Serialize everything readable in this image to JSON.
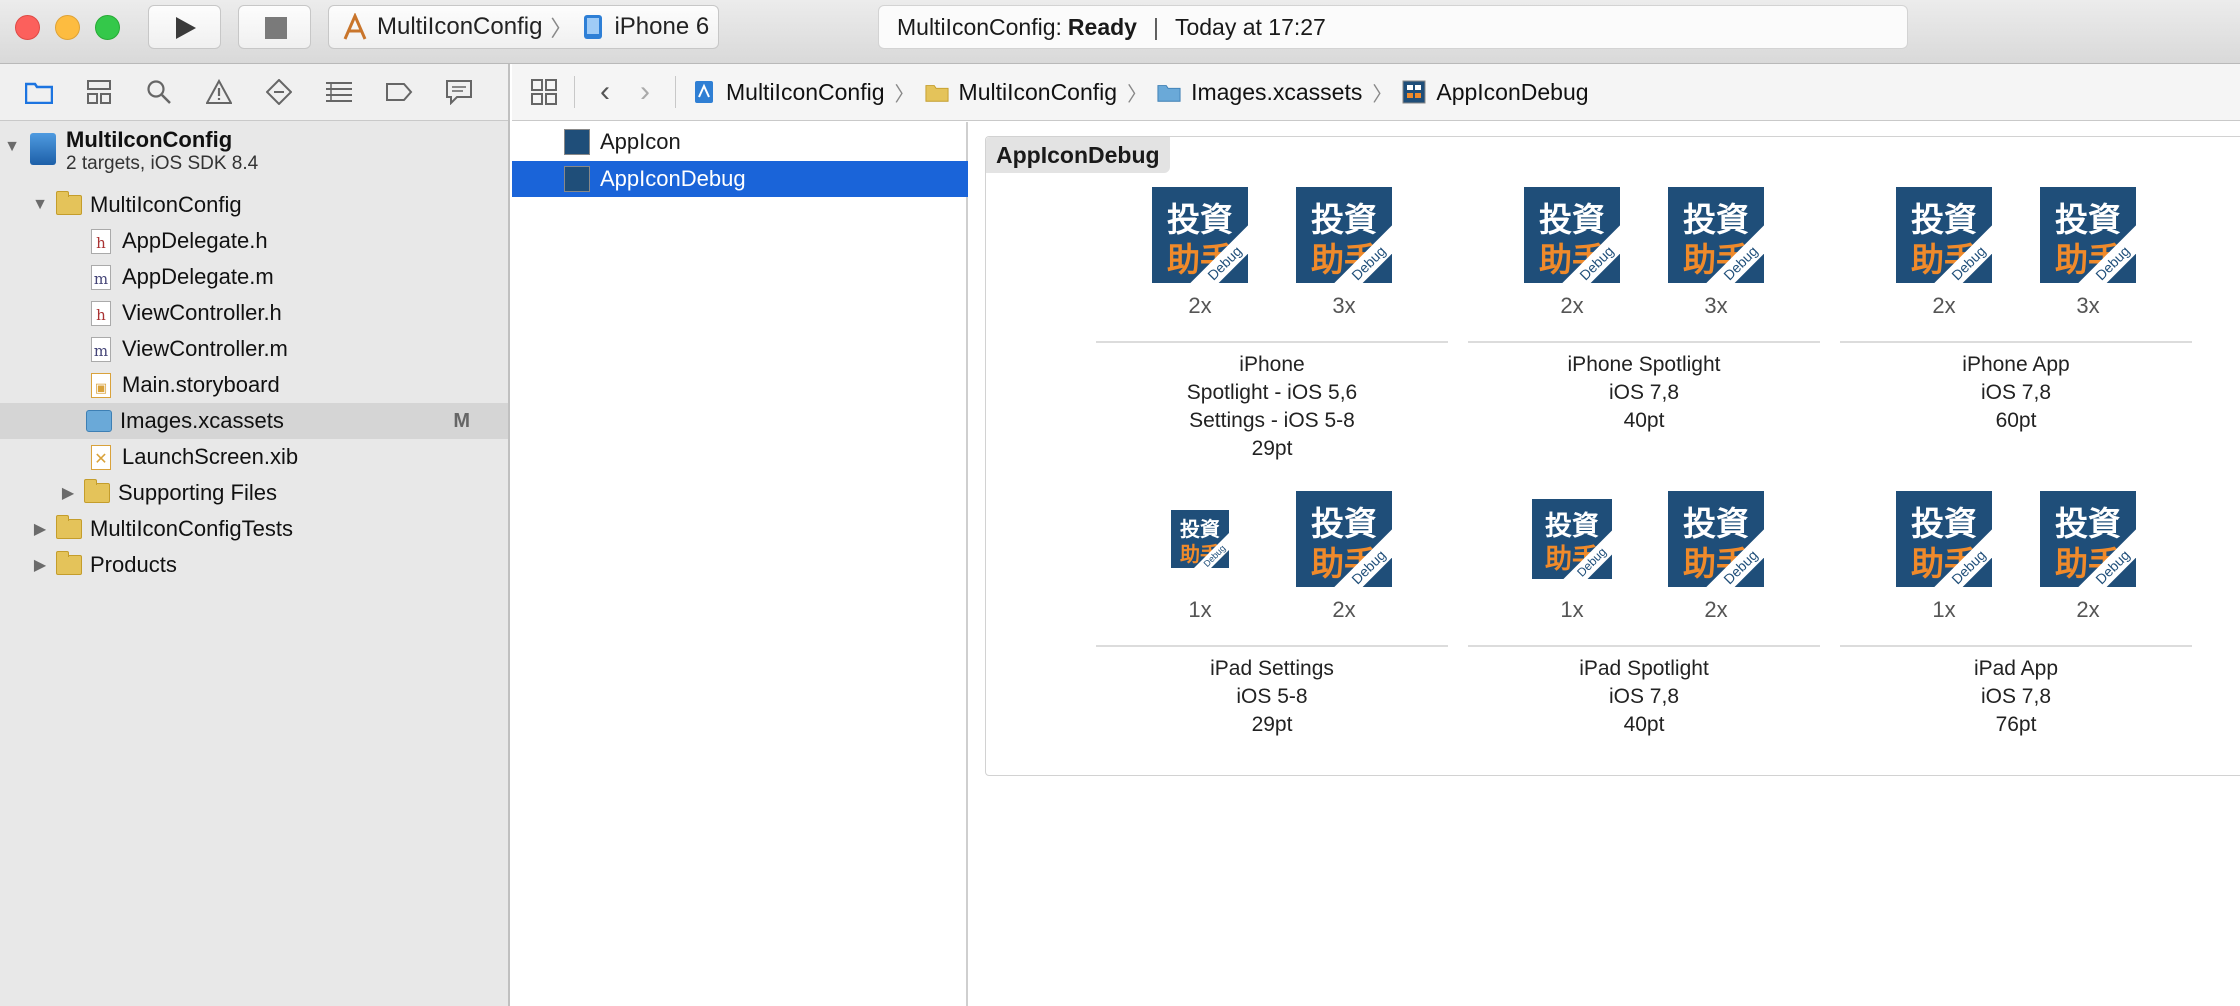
{
  "toolbar": {
    "scheme_target": "MultiIconConfig",
    "scheme_device": "iPhone 6",
    "status_project": "MultiIconConfig:",
    "status_state": "Ready",
    "status_time": "Today at 17:27"
  },
  "navigator": {
    "project": {
      "name": "MultiIconConfig",
      "subtitle": "2 targets, iOS SDK 8.4"
    },
    "items": [
      {
        "label": "MultiIconConfig"
      },
      {
        "label": "AppDelegate.h"
      },
      {
        "label": "AppDelegate.m"
      },
      {
        "label": "ViewController.h"
      },
      {
        "label": "ViewController.m"
      },
      {
        "label": "Main.storyboard"
      },
      {
        "label": "Images.xcassets",
        "badge": "M"
      },
      {
        "label": "LaunchScreen.xib"
      },
      {
        "label": "Supporting Files"
      },
      {
        "label": "MultiIconConfigTests"
      },
      {
        "label": "Products"
      }
    ]
  },
  "jumpbar": {
    "crumbs": [
      "MultiIconConfig",
      "MultiIconConfig",
      "Images.xcassets",
      "AppIconDebug"
    ]
  },
  "assets": {
    "items": [
      {
        "label": "AppIcon"
      },
      {
        "label": "AppIconDebug"
      }
    ]
  },
  "icon_set": {
    "title": "AppIconDebug",
    "icon_text_top": "投資",
    "icon_text_bottom": "助手",
    "icon_ribbon": "Debug",
    "groups": [
      {
        "scales": [
          "2x",
          "3x"
        ],
        "caption": [
          "iPhone",
          "Spotlight - iOS 5,6",
          "Settings - iOS 5-8",
          "29pt"
        ]
      },
      {
        "scales": [
          "2x",
          "3x"
        ],
        "caption": [
          "iPhone Spotlight",
          "iOS 7,8",
          "40pt"
        ]
      },
      {
        "scales": [
          "2x",
          "3x"
        ],
        "caption": [
          "iPhone App",
          "iOS 7,8",
          "60pt"
        ]
      },
      {
        "scales": [
          "1x",
          "2x"
        ],
        "caption": [
          "iPad Settings",
          "iOS 5-8",
          "29pt"
        ]
      },
      {
        "scales": [
          "1x",
          "2x"
        ],
        "caption": [
          "iPad Spotlight",
          "iOS 7,8",
          "40pt"
        ]
      },
      {
        "scales": [
          "1x",
          "2x"
        ],
        "caption": [
          "iPad App",
          "iOS 7,8",
          "76pt"
        ]
      }
    ]
  },
  "colors": {
    "selection_blue": "#1a64d9",
    "icon_navy": "#1f4e79",
    "icon_orange": "#f08a2a"
  }
}
